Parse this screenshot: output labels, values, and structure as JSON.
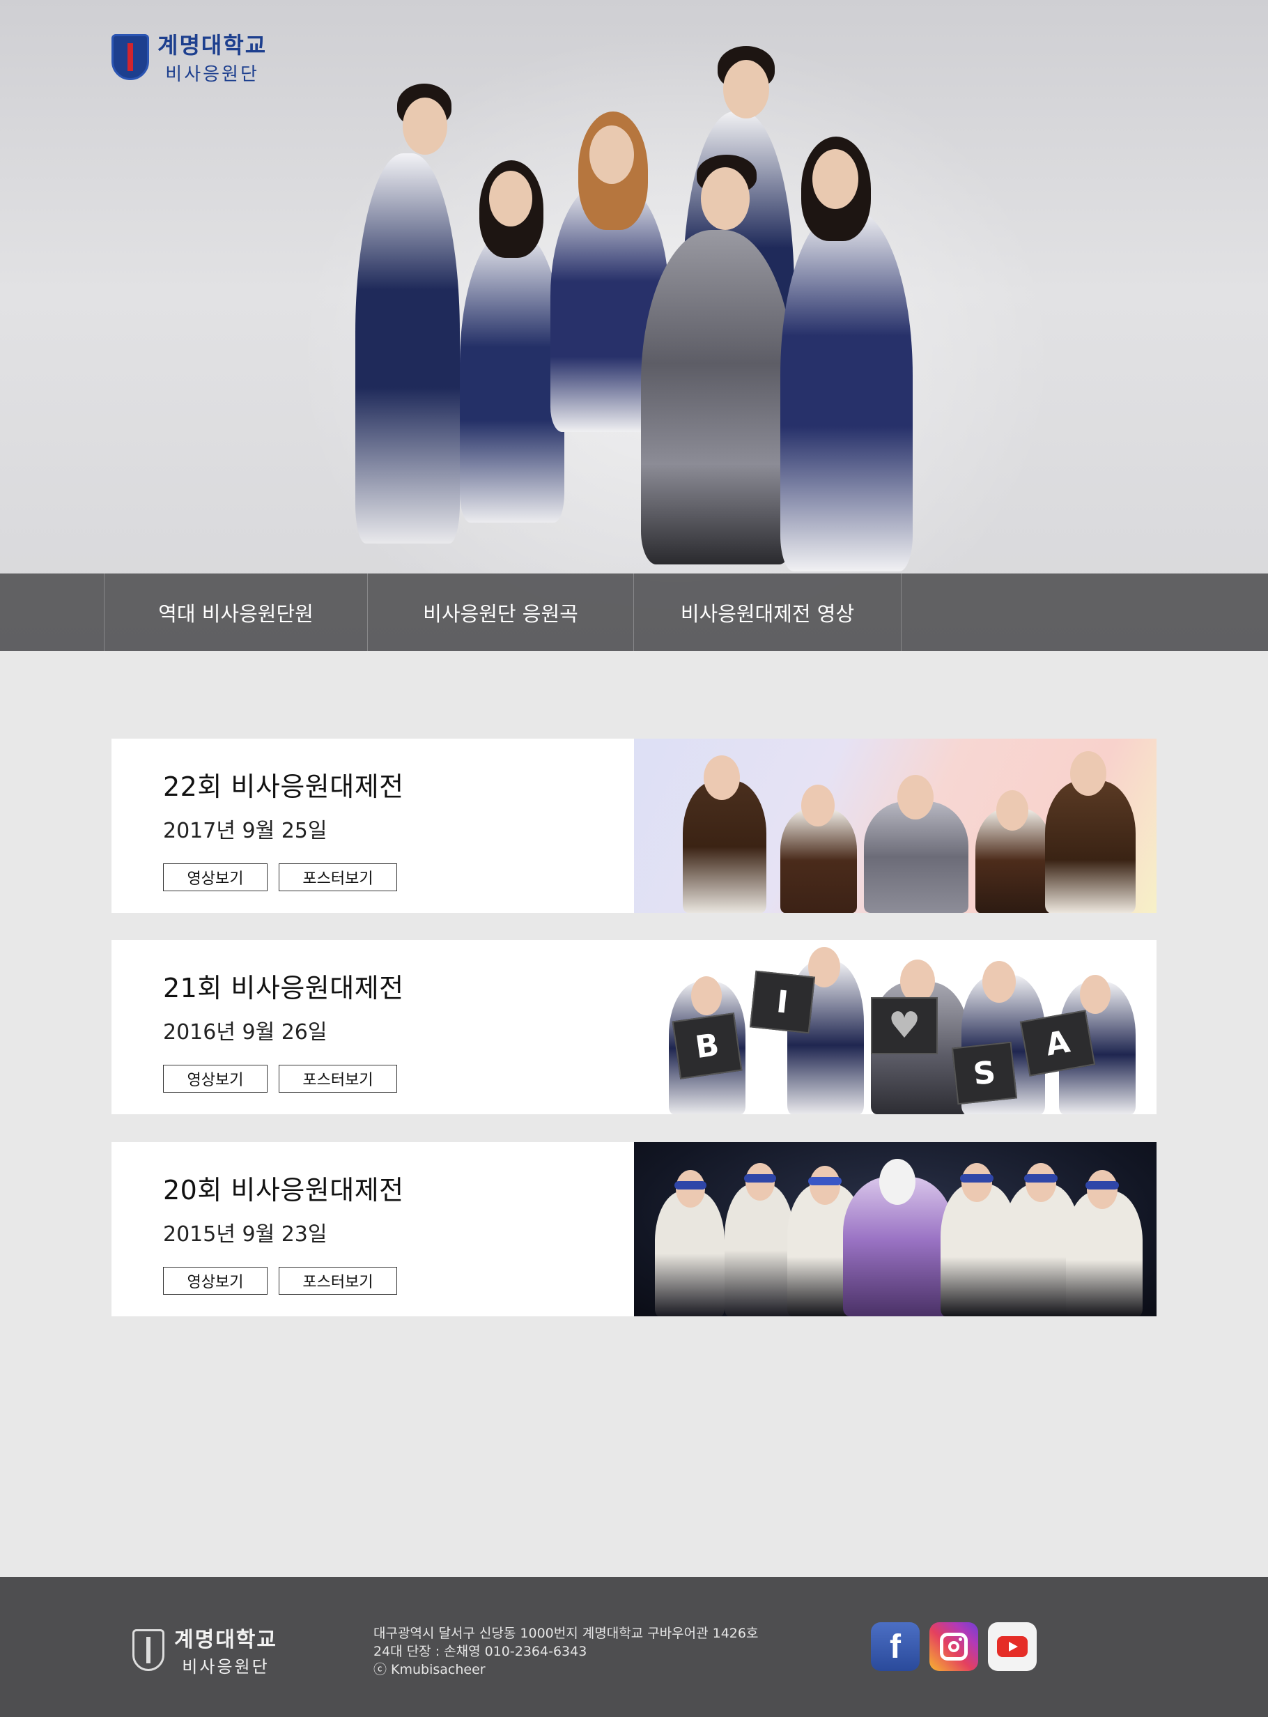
{
  "logo": {
    "name1": "계명대학교",
    "name2": "비사응원단"
  },
  "nav": {
    "items": [
      "역대 비사응원단원",
      "비사응원단 응원곡",
      "비사응원대제전 영상"
    ]
  },
  "events": [
    {
      "title": "22회 비사응원대제전",
      "date": "2017년 9월 25일",
      "video_label": "영상보기",
      "poster_label": "포스터보기"
    },
    {
      "title": "21회 비사응원대제전",
      "date": "2016년 9월 26일",
      "video_label": "영상보기",
      "poster_label": "포스터보기",
      "sign_letters": [
        "B",
        "I",
        "♥",
        "S",
        "A"
      ]
    },
    {
      "title": "20회 비사응원대제전",
      "date": "2015년 9월 23일",
      "video_label": "영상보기",
      "poster_label": "포스터보기"
    }
  ],
  "footer": {
    "name1": "계명대학교",
    "name2": "비사응원단",
    "address": "대구광역시 달서구 신당동 1000번지 계명대학교 구바우어관 1426호",
    "leader": "24대 단장 : 손채영  010-2364-6343",
    "copyright": "ⓒ Kmubisacheer",
    "social": [
      {
        "icon": "facebook-icon",
        "glyph": "f"
      },
      {
        "icon": "instagram-icon"
      },
      {
        "icon": "youtube-icon"
      }
    ]
  },
  "colors": {
    "nav_bg": "#505052",
    "footer_bg": "#4e4e50",
    "brand_blue": "#1d3f8e",
    "page_bg": "#e8e8e8"
  }
}
